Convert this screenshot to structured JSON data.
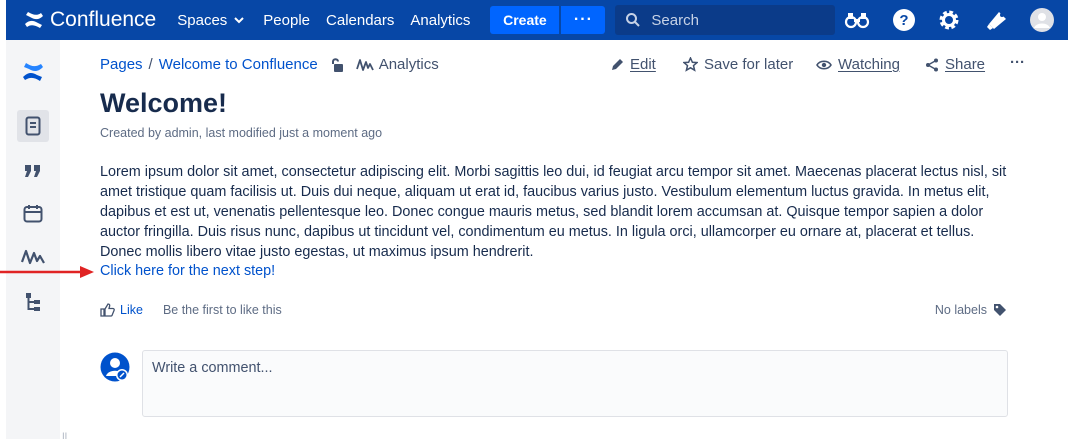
{
  "topnav": {
    "brand": "Confluence",
    "items": [
      "Spaces",
      "People",
      "Calendars",
      "Analytics"
    ],
    "create_label": "Create",
    "more_label": "···",
    "search_placeholder": "Search",
    "bg_color": "#0747a6"
  },
  "breadcrumb": {
    "pages": "Pages",
    "separator": "/",
    "page": "Welcome to Confluence",
    "analytics": "Analytics"
  },
  "actions": {
    "edit": "Edit",
    "save_for_later": "Save for later",
    "watching": "Watching",
    "share": "Share",
    "more": "···"
  },
  "page": {
    "title": "Welcome!",
    "meta": "Created by admin, last modified just a moment ago",
    "body": "Lorem ipsum dolor sit amet, consectetur adipiscing elit. Morbi sagittis leo dui, id feugiat arcu tempor sit amet. Maecenas placerat lectus nisl, sit amet tristique quam facilisis ut. Duis dui neque, aliquam ut erat id, faucibus varius justo. Vestibulum elementum luctus gravida. In metus elit, dapibus et est ut, venenatis pellentesque leo. Donec congue mauris metus, sed blandit lorem accumsan at. Quisque tempor sapien a dolor auctor fringilla. Duis risus nunc, dapibus ut tincidunt vel, condimentum eu metus. In ligula orci, ullamcorper eu ornare at, placerat et tellus. Donec mollis libero vitae justo egestas, ut maximus ipsum hendrerit.",
    "link": "Click here for the next step!"
  },
  "footer": {
    "like": "Like",
    "like_text": "Be the first to like this",
    "labels": "No labels",
    "comment_placeholder": "Write a comment..."
  },
  "colors": {
    "accent": "#0052cc",
    "annotation_arrow": "#e02424"
  }
}
